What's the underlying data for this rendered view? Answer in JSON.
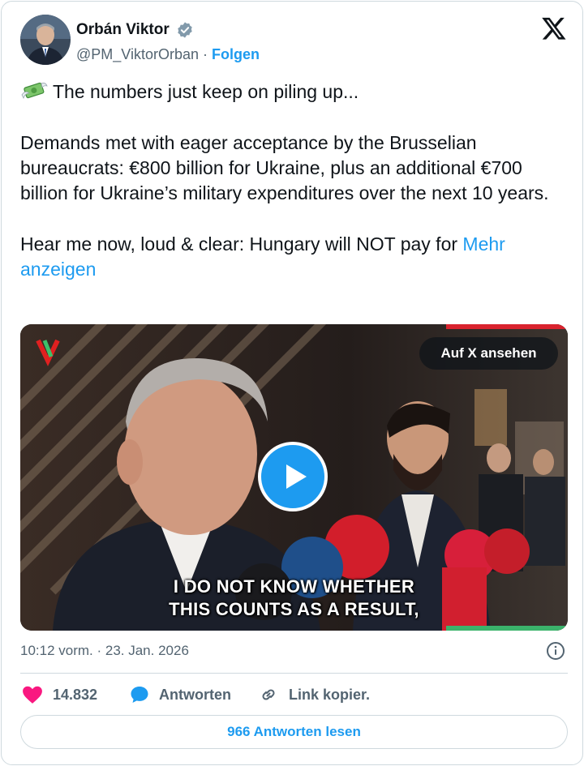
{
  "author": {
    "name": "Orbán Viktor",
    "handle": "@PM_ViktorOrban",
    "separator": " · ",
    "follow_label": "Folgen"
  },
  "icons": {
    "avatar": "avatar-photo",
    "verified": "verified-badge-icon",
    "platform": "x-logo-icon",
    "emoji": "money-with-wings-icon",
    "play": "play-icon",
    "info": "info-icon",
    "like": "heart-icon",
    "reply": "speech-bubble-icon",
    "copy": "link-icon"
  },
  "tweet": {
    "line1": "The numbers just keep on piling up...",
    "para2": "Demands met with eager acceptance by the Brusselian bureaucrats: €800 billion for Ukraine, plus an additional €700 billion for Ukraine’s military expenditures over the next 10 years.",
    "para3": "Hear me now, loud & clear: Hungary will NOT pay for ",
    "more_label": "Mehr anzeigen"
  },
  "media": {
    "watch_label": "Auf X ansehen",
    "caption_line1": "I DO NOT KNOW WHETHER",
    "caption_line2": "THIS COUNTS AS A RESULT,",
    "progress": 0.0
  },
  "meta": {
    "timestamp": "10:12 vorm. · 23. Jan. 2026"
  },
  "actions": {
    "like_count": "14.832",
    "reply_label": "Antworten",
    "copy_label": "Link kopier."
  },
  "footer": {
    "read_replies_label": "966 Antworten lesen"
  },
  "colors": {
    "accent": "#1d9bf0",
    "like": "#f91880",
    "muted": "#536471",
    "text": "#0f1419",
    "border": "#cfd9de"
  }
}
